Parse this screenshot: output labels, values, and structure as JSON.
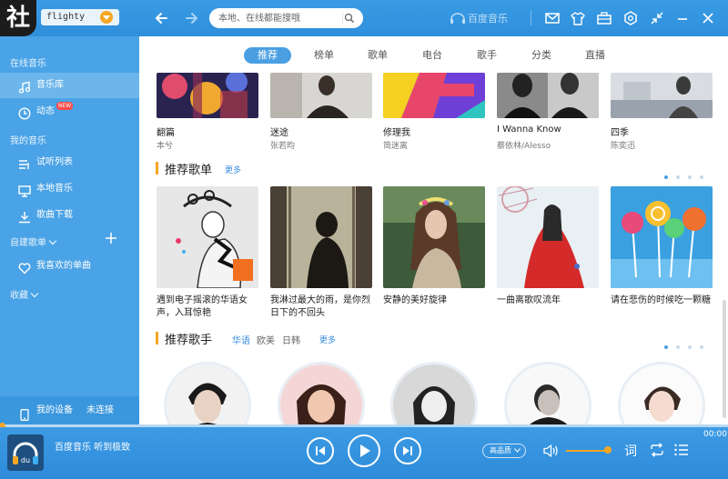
{
  "titlebar": {
    "logo_glyph": "社",
    "user_name": "flighty",
    "search_placeholder": "本地、在线都能搜哦",
    "brand": "百度音乐"
  },
  "sidebar": {
    "section_online": "在线音乐",
    "item_library": "音乐库",
    "item_feed": "动态",
    "new_badge": "NEW",
    "section_my_music": "我的音乐",
    "item_trial_list": "试听列表",
    "item_local": "本地音乐",
    "item_download": "歌曲下载",
    "section_playlists": "自建歌单",
    "item_favorites": "我喜欢的单曲",
    "section_collection": "收藏",
    "device_label": "我的设备",
    "device_status": "未连接"
  },
  "tabs": [
    "推荐",
    "榜单",
    "歌单",
    "电台",
    "歌手",
    "分类",
    "直播"
  ],
  "albums": [
    {
      "title": "翻篇",
      "artist": "本兮"
    },
    {
      "title": "迷途",
      "artist": "张若昀"
    },
    {
      "title": "修理我",
      "artist": "简迷离"
    },
    {
      "title": "I Wanna Know",
      "artist": "蔡依林/Alesso"
    },
    {
      "title": "四季",
      "artist": "陈奕迅"
    }
  ],
  "playlists_section": {
    "title": "推荐歌单",
    "more": "更多",
    "items": [
      "遇到电子摇滚的华语女声，入耳惊艳",
      "我淋过最大的雨，是你烈日下的不回头",
      "安静的美好旋律",
      "一曲离歌叹流年",
      "请在悲伤的时候吃一颗糖"
    ]
  },
  "singers_section": {
    "title": "推荐歌手",
    "sub_tabs": [
      "华语",
      "欧美",
      "日韩"
    ],
    "more": "更多"
  },
  "player": {
    "time": "00:00",
    "now_playing": "百度音乐 听到极致",
    "quality": "高品质",
    "lyrics_label": "词"
  }
}
